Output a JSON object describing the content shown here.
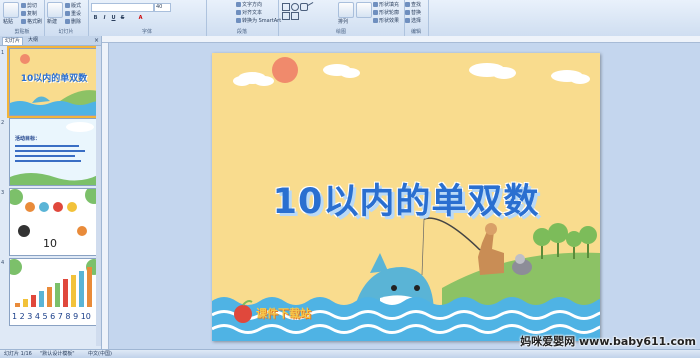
{
  "ribbon": {
    "groups": [
      "剪贴板",
      "幻灯片",
      "字体",
      "段落",
      "绘图",
      "编辑"
    ],
    "clipboard": {
      "paste": "粘贴",
      "cut": "剪切",
      "copy": "复制",
      "format_painter": "格式刷"
    },
    "slides": {
      "new_slide": "新建",
      "layout": "版式",
      "reset": "重设",
      "delete": "删除"
    },
    "font": {
      "font_name": "",
      "font_size": "40"
    },
    "paragraph": {
      "text_direction": "文字方向",
      "align_text": "对齐文本",
      "convert_smartart": "转换为 SmartArt"
    },
    "drawing": {
      "arrange": "排列",
      "quick_styles": "快速样式",
      "shape_fill": "形状填充",
      "shape_outline": "形状轮廓",
      "shape_effects": "形状效果"
    },
    "editing": {
      "find": "查找",
      "replace": "替换",
      "select": "选择"
    }
  },
  "outline_pane": {
    "tabs": [
      "幻灯片",
      "大纲"
    ],
    "slides": [
      {
        "number": "1",
        "title": "10以内的单双数"
      },
      {
        "number": "2",
        "text": "活动目标："
      },
      {
        "number": "3",
        "text": "10"
      },
      {
        "number": "4",
        "text": "1 2 3 4 5 6 7 8 9 10"
      }
    ]
  },
  "slide": {
    "title": "10以内的单双数",
    "logo_text": "课件下载站"
  },
  "statusbar": {
    "slide_info": "幻灯片 1/16",
    "theme": "\"默认设计模板\"",
    "language": "中文(中国)"
  },
  "watermark": "妈咪爱婴网 www.baby611.com",
  "colors": {
    "title_blue": "#2a6fd0",
    "slide_bg": "#f9dc8e",
    "water": "#4fb3e4",
    "ribbon_bg": "#dbe7f5"
  }
}
